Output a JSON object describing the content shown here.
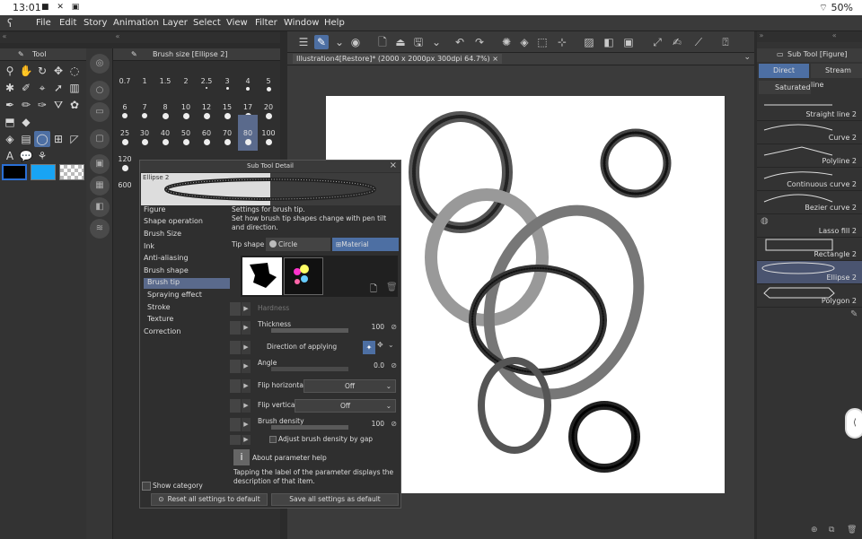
{
  "status": {
    "time": "13:01",
    "battery": "50%"
  },
  "menu": [
    "File",
    "Edit",
    "Story",
    "Animation",
    "Layer",
    "Select",
    "View",
    "Filter",
    "Window",
    "Help"
  ],
  "panels": {
    "tool": "Tool",
    "brush_size": "Brush size [Ellipse 2]",
    "sub_tool": "Sub Tool [Figure]"
  },
  "brush_sizes": [
    "0.7",
    "1",
    "1.5",
    "2",
    "2.5",
    "3",
    "4",
    "5",
    "6",
    "7",
    "8",
    "10",
    "12",
    "15",
    "17",
    "20",
    "25",
    "30",
    "40",
    "50",
    "60",
    "70",
    "80",
    "100",
    "120",
    "600"
  ],
  "doc_tab": "Illustration4[Restore]* (2000 x 2000px 300dpi 64.7%)",
  "right_panel": {
    "tabs": [
      "Direct draw",
      "Stream line"
    ],
    "saturated": "Saturated",
    "items": [
      "Straight line 2",
      "Curve 2",
      "Polyline 2",
      "Continuous curve 2",
      "Bezier curve 2",
      "Lasso fill 2",
      "Rectangle 2",
      "Ellipse 2",
      "Polygon 2"
    ]
  },
  "dialog": {
    "title": "Sub Tool Detail",
    "preview_name": "Ellipse 2",
    "categories": [
      "Figure",
      "Shape operation",
      "Brush Size",
      "Ink",
      "Anti-aliasing",
      "Brush shape",
      "Brush tip",
      "Spraying effect",
      "Stroke",
      "Texture",
      "Correction"
    ],
    "desc_title": "Settings for brush tip.",
    "desc": "Set how brush tip shapes change with pen tilt and direction.",
    "tip_shape": "Tip shape",
    "circle": "Circle",
    "material": "Material",
    "hardness": "Hardness",
    "thickness": "Thickness",
    "thickness_val": "100",
    "direction": "Direction of applying",
    "angle": "Angle",
    "angle_val": "0.0",
    "flip_h": "Flip horizontal",
    "flip_h_val": "Off",
    "flip_v": "Flip vertical",
    "flip_v_val": "Off",
    "density": "Brush density",
    "density_val": "100",
    "adjust": "Adjust brush density by gap",
    "about": "About parameter help",
    "about_desc": "Tapping the label of the parameter displays the description of that item.",
    "show_category": "Show category",
    "reset": "Reset all settings to default",
    "save": "Save all settings as default"
  }
}
